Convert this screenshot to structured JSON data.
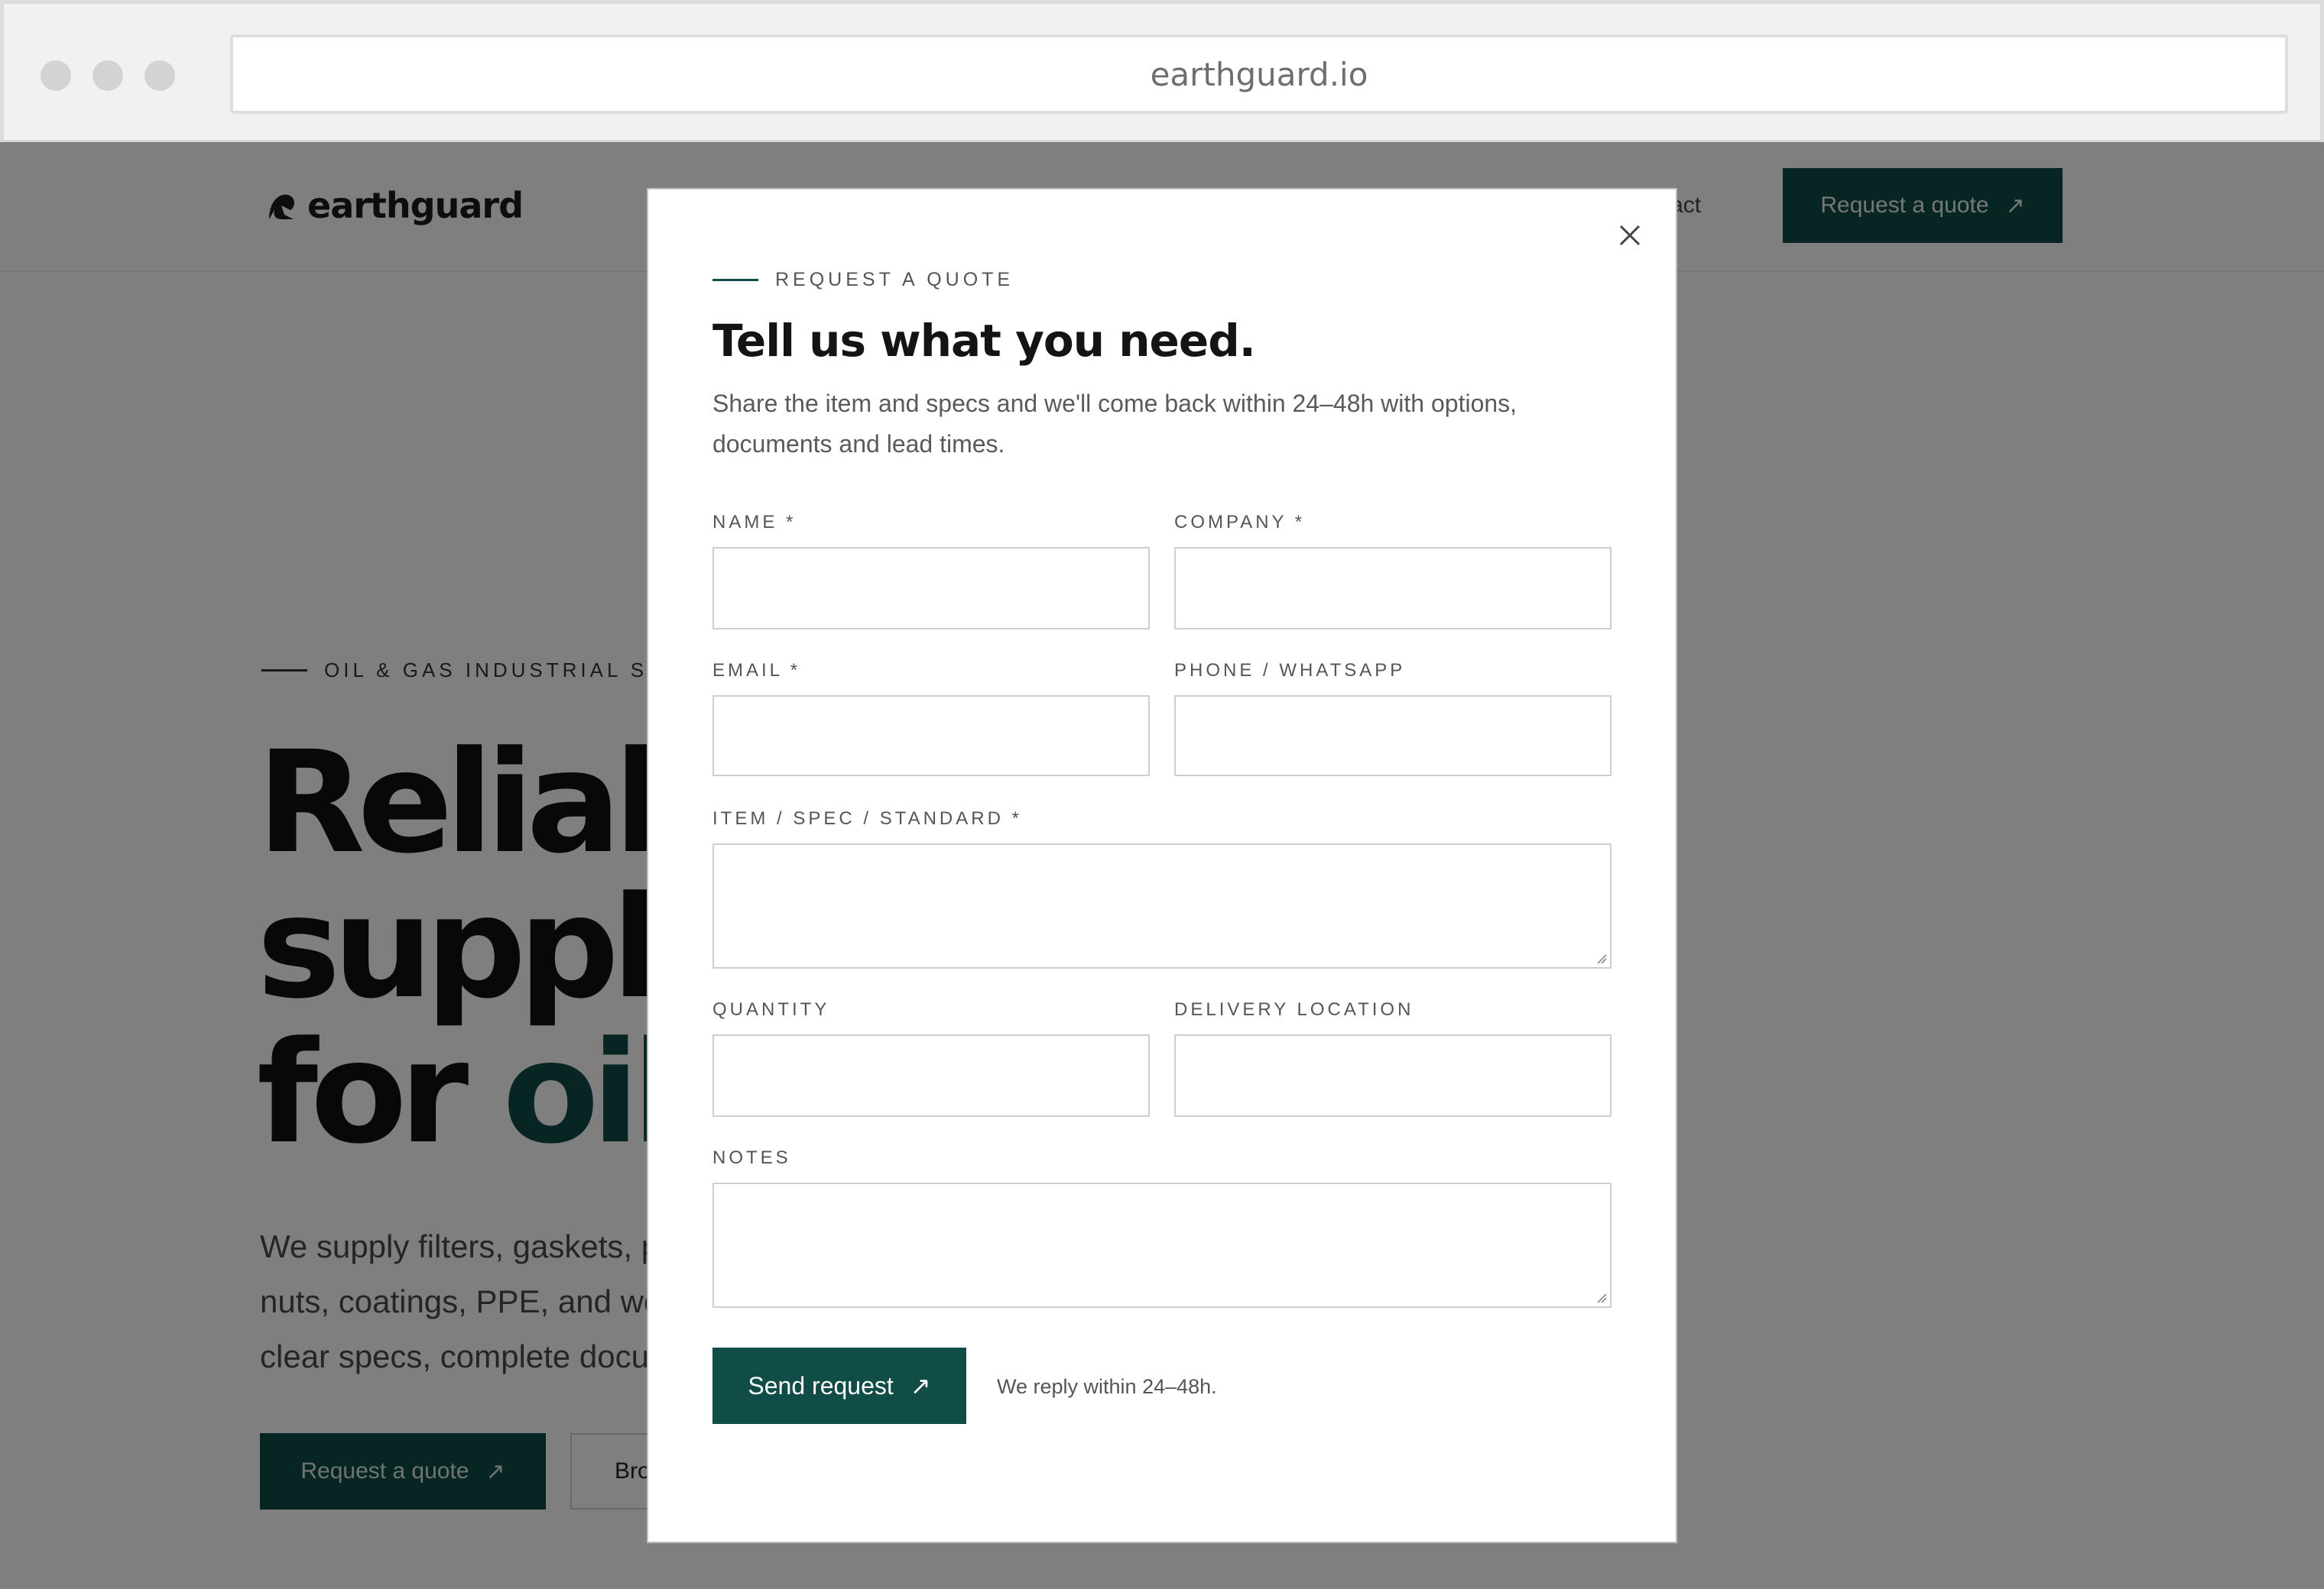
{
  "browser": {
    "url": "earthguard.io"
  },
  "site": {
    "logo_text": "earthguard",
    "nav": {
      "contact_partial": "ntact",
      "cta_label": "Request a quote",
      "cta_icon": "arrow-up-right-icon"
    },
    "hero": {
      "eyebrow": "OIL & GAS INDUSTRIAL SUP",
      "title_line1": "Reliab",
      "title_line2": "supply",
      "title_line3_plain": "for ",
      "title_line3_accent": "oil",
      "subtitle_line1": "We supply filters, gaskets, p",
      "subtitle_line2": "nuts, coatings, PPE, and wo",
      "subtitle_line3": "clear specs, complete docu",
      "primary_button": "Request a quote",
      "secondary_button": "Bro"
    }
  },
  "modal": {
    "eyebrow": "REQUEST A QUOTE",
    "title": "Tell us what you need.",
    "description": "Share the item and specs and we'll come back within 24–48h with options, documents and lead times.",
    "fields": {
      "name": "NAME *",
      "company": "COMPANY *",
      "email": "EMAIL *",
      "phone": "PHONE / WHATSAPP",
      "item": "ITEM / SPEC / STANDARD *",
      "quantity": "QUANTITY",
      "delivery": "DELIVERY LOCATION",
      "notes": "NOTES"
    },
    "submit_label": "Send request",
    "reply_note": "We reply within 24–48h."
  },
  "colors": {
    "brand": "#0f4d46",
    "overlay": "rgba(0,0,0,0.5)"
  }
}
